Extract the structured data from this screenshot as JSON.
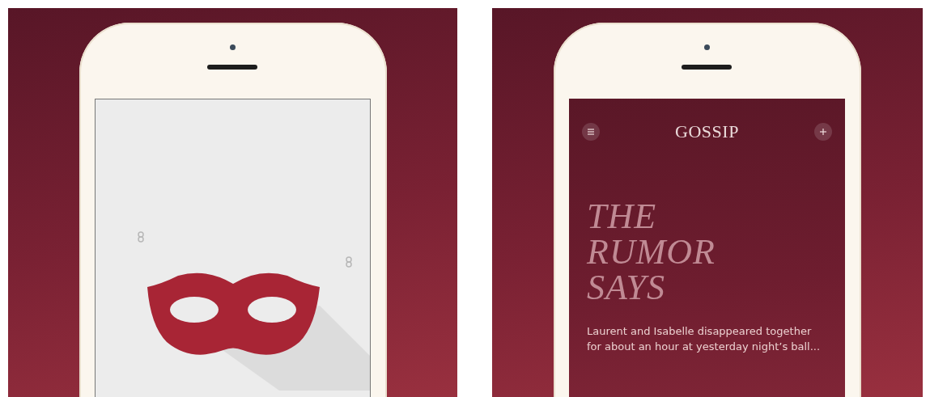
{
  "screens": [
    {
      "kind": "splash"
    },
    {
      "kind": "feed",
      "logo": "GOSSIP",
      "headline": "THE RUMOR SAYS",
      "body": "Laurent and Isabelle disappeared together for about an hour at yesterday night’s ball..."
    }
  ]
}
